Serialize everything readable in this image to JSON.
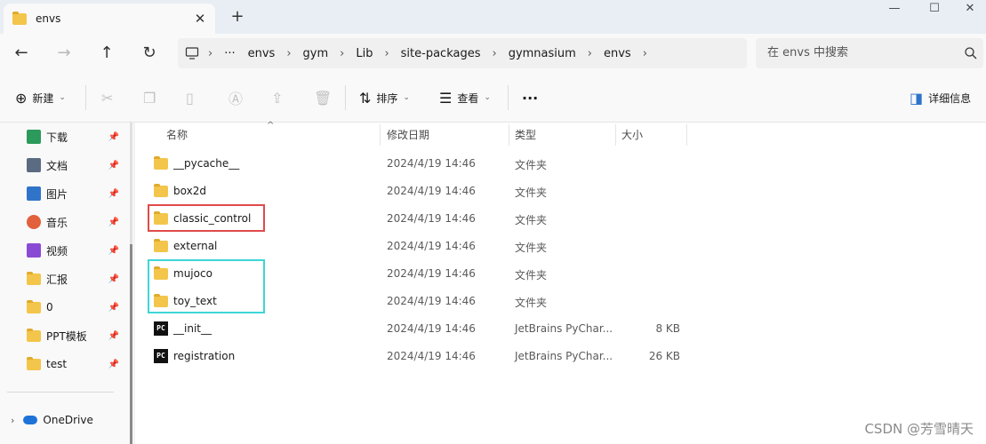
{
  "tab": {
    "title": "envs",
    "close_label": "✕"
  },
  "new_tab_label": "+",
  "window_controls": {
    "minimize": "—",
    "maximize": "☐",
    "close": "✕"
  },
  "nav": {
    "back": "←",
    "forward": "→",
    "up": "↑",
    "refresh": "↻"
  },
  "breadcrumb": {
    "ellipsis": "···",
    "segments": [
      "envs",
      "gym",
      "Lib",
      "site-packages",
      "gymnasium",
      "envs"
    ]
  },
  "search": {
    "placeholder": "在 envs 中搜索"
  },
  "commands": {
    "new": "新建",
    "sort": "排序",
    "view": "查看",
    "more": "···",
    "details": "详细信息"
  },
  "sidebar": {
    "items": [
      {
        "label": "下载",
        "icon": "download-icon",
        "color": "#2b9a5a"
      },
      {
        "label": "文档",
        "icon": "document-icon",
        "color": "#5a6b82"
      },
      {
        "label": "图片",
        "icon": "picture-icon",
        "color": "#2f74c9"
      },
      {
        "label": "音乐",
        "icon": "music-icon",
        "color": "#e2603c"
      },
      {
        "label": "视频",
        "icon": "video-icon",
        "color": "#8a4bd4"
      },
      {
        "label": "汇报",
        "icon": "folder-icon",
        "color": "#f3c54a"
      },
      {
        "label": "0",
        "icon": "folder-icon",
        "color": "#f3c54a"
      },
      {
        "label": "PPT模板",
        "icon": "folder-icon",
        "color": "#f3c54a"
      },
      {
        "label": "test",
        "icon": "folder-icon",
        "color": "#f3c54a"
      }
    ],
    "onedrive": "OneDrive"
  },
  "columns": {
    "name": "名称",
    "date": "修改日期",
    "type": "类型",
    "size": "大小"
  },
  "files": [
    {
      "name": "__pycache__",
      "date": "2024/4/19 14:46",
      "type": "文件夹",
      "size": "",
      "kind": "folder"
    },
    {
      "name": "box2d",
      "date": "2024/4/19 14:46",
      "type": "文件夹",
      "size": "",
      "kind": "folder"
    },
    {
      "name": "classic_control",
      "date": "2024/4/19 14:46",
      "type": "文件夹",
      "size": "",
      "kind": "folder"
    },
    {
      "name": "external",
      "date": "2024/4/19 14:46",
      "type": "文件夹",
      "size": "",
      "kind": "folder"
    },
    {
      "name": "mujoco",
      "date": "2024/4/19 14:46",
      "type": "文件夹",
      "size": "",
      "kind": "folder"
    },
    {
      "name": "toy_text",
      "date": "2024/4/19 14:46",
      "type": "文件夹",
      "size": "",
      "kind": "folder"
    },
    {
      "name": "__init__",
      "date": "2024/4/19 14:46",
      "type": "JetBrains PyChar...",
      "size": "8 KB",
      "kind": "python"
    },
    {
      "name": "registration",
      "date": "2024/4/19 14:46",
      "type": "JetBrains PyChar...",
      "size": "26 KB",
      "kind": "python"
    }
  ],
  "watermark": "CSDN @芳雪晴天",
  "colors": {
    "highlight_red": "#e04a4a",
    "highlight_cyan": "#3fd6d6",
    "folder": "#f3c54a"
  }
}
